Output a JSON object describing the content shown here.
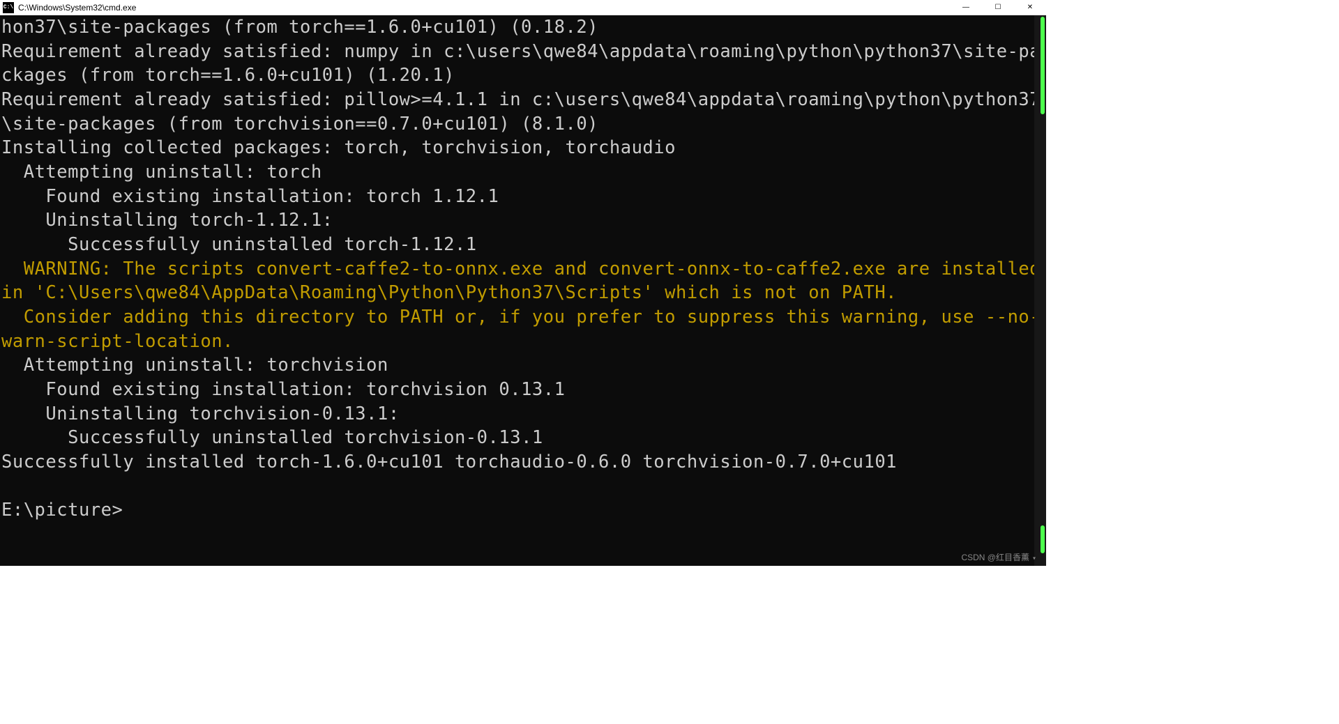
{
  "titlebar": {
    "icon_label": "C:\\",
    "title": "C:\\Windows\\System32\\cmd.exe"
  },
  "window_controls": {
    "minimize": "—",
    "maximize": "☐",
    "close": "✕"
  },
  "terminal": {
    "lines": [
      {
        "class": "white-text",
        "text": "hon37\\site-packages (from torch==1.6.0+cu101) (0.18.2)"
      },
      {
        "class": "white-text",
        "text": "Requirement already satisfied: numpy in c:\\users\\qwe84\\appdata\\roaming\\python\\python37\\site-packages (from torch==1.6.0+cu101) (1.20.1)"
      },
      {
        "class": "white-text",
        "text": "Requirement already satisfied: pillow>=4.1.1 in c:\\users\\qwe84\\appdata\\roaming\\python\\python37\\site-packages (from torchvision==0.7.0+cu101) (8.1.0)"
      },
      {
        "class": "white-text",
        "text": "Installing collected packages: torch, torchvision, torchaudio"
      },
      {
        "class": "white-text",
        "text": "  Attempting uninstall: torch"
      },
      {
        "class": "white-text",
        "text": "    Found existing installation: torch 1.12.1"
      },
      {
        "class": "white-text",
        "text": "    Uninstalling torch-1.12.1:"
      },
      {
        "class": "white-text",
        "text": "      Successfully uninstalled torch-1.12.1"
      },
      {
        "class": "yellow-text",
        "text": "  WARNING: The scripts convert-caffe2-to-onnx.exe and convert-onnx-to-caffe2.exe are installed in 'C:\\Users\\qwe84\\AppData\\Roaming\\Python\\Python37\\Scripts' which is not on PATH."
      },
      {
        "class": "yellow-text",
        "text": "  Consider adding this directory to PATH or, if you prefer to suppress this warning, use --no-warn-script-location."
      },
      {
        "class": "white-text",
        "text": "  Attempting uninstall: torchvision"
      },
      {
        "class": "white-text",
        "text": "    Found existing installation: torchvision 0.13.1"
      },
      {
        "class": "white-text",
        "text": "    Uninstalling torchvision-0.13.1:"
      },
      {
        "class": "white-text",
        "text": "      Successfully uninstalled torchvision-0.13.1"
      },
      {
        "class": "white-text",
        "text": "Successfully installed torch-1.6.0+cu101 torchaudio-0.6.0 torchvision-0.7.0+cu101"
      },
      {
        "class": "white-text",
        "text": ""
      },
      {
        "class": "white-text",
        "text": "E:\\picture>"
      }
    ]
  },
  "watermark": {
    "text": "CSDN @红目香薰"
  }
}
